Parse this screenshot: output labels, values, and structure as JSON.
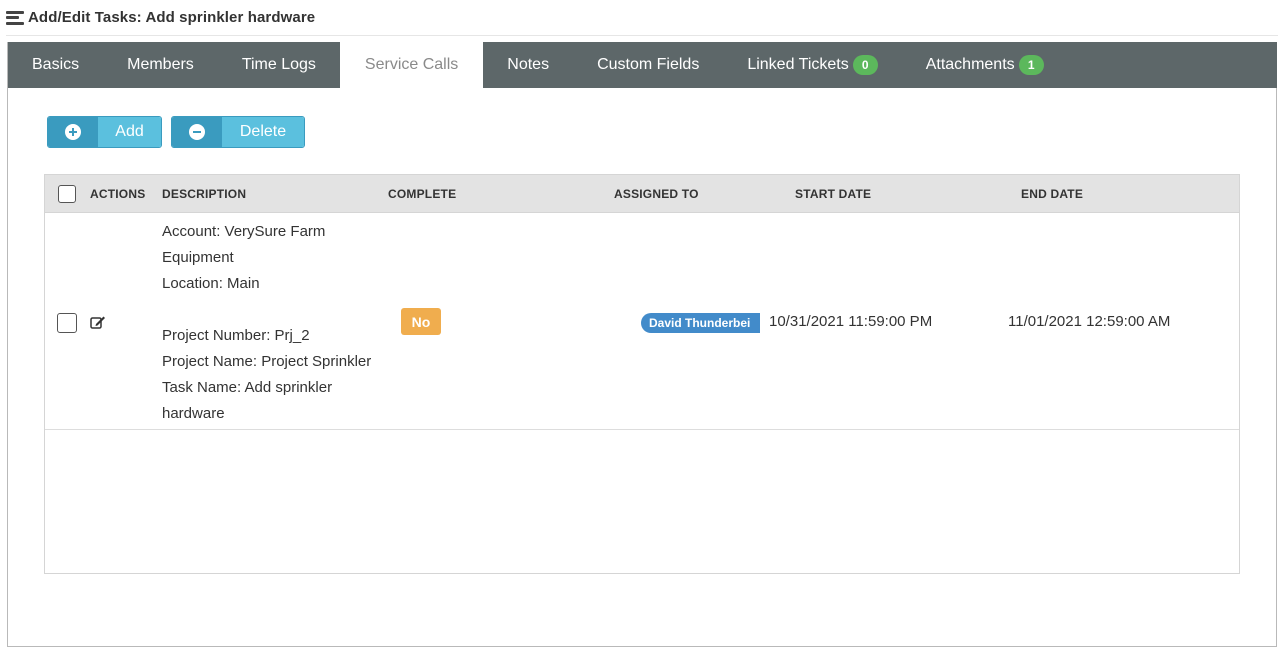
{
  "header": {
    "title": "Add/Edit Tasks: Add sprinkler hardware",
    "icon": "list-icon"
  },
  "tabs": [
    {
      "label": "Basics",
      "badge": null,
      "active": false
    },
    {
      "label": "Members",
      "badge": null,
      "active": false
    },
    {
      "label": "Time Logs",
      "badge": null,
      "active": false
    },
    {
      "label": "Service Calls",
      "badge": null,
      "active": true
    },
    {
      "label": "Notes",
      "badge": null,
      "active": false
    },
    {
      "label": "Custom Fields",
      "badge": null,
      "active": false
    },
    {
      "label": "Linked Tickets",
      "badge": "0",
      "active": false
    },
    {
      "label": "Attachments",
      "badge": "1",
      "active": false
    }
  ],
  "toolbar": {
    "add_label": "Add",
    "delete_label": "Delete"
  },
  "table": {
    "columns": [
      "ACTIONS",
      "DESCRIPTION",
      "COMPLETE",
      "ASSIGNED TO",
      "START DATE",
      "END DATE"
    ],
    "rows": [
      {
        "description": {
          "line1": "Account: VerySure Farm",
          "line2": "Equipment",
          "line3": "Location: Main",
          "line4": "Project Number: Prj_2",
          "line5": "Project Name: Project Sprinkler",
          "line6": "Task Name: Add sprinkler",
          "line7": "hardware"
        },
        "complete": "No",
        "assigned_to": "David Thunderbei",
        "start_date": "10/31/2021 11:59:00 PM",
        "end_date": "11/01/2021 12:59:00 AM"
      }
    ]
  },
  "colors": {
    "tab_bar": "#5d6769",
    "button_icon": "#3a9bbf",
    "button_label": "#5bc0de",
    "badge_green": "#5cb85c",
    "complete_no": "#f0ad4e",
    "assignee": "#428bca"
  }
}
